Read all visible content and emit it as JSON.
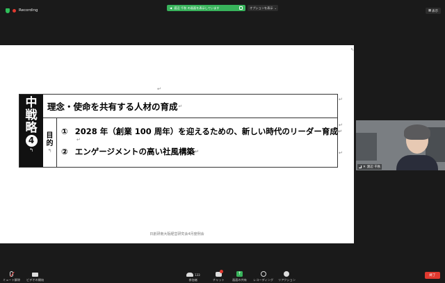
{
  "topbar": {
    "recording_label": "Recording",
    "share_notice": "渡辺 千秋 の画面を表示しています",
    "options_label": "オプションを表示",
    "view_label": "表示"
  },
  "slide": {
    "strategy_label_chars": [
      "中",
      "戦",
      "略"
    ],
    "strategy_number": "4",
    "title": "理念・使命を共有する人材の育成",
    "purpose_chars": [
      "目",
      "的"
    ],
    "items": [
      {
        "marker": "①",
        "text": "2028 年（創業 100 周年）を迎えるための、新しい時代のリーダー育成"
      },
      {
        "marker": "②",
        "text": "エンゲージメントの高い社風構築"
      }
    ],
    "footer": "日創研南大阪経営研究会4月度例会",
    "paragraph_mark": "↵",
    "return_mark": "↰"
  },
  "participant": {
    "name": "渡辺 千秋"
  },
  "toolbar": {
    "mute": "ミュート解除",
    "video": "ビデオの開始",
    "participants": "参加者",
    "participants_count": "133",
    "chat": "チャット",
    "share": "画面の共有",
    "record": "レコーディング",
    "reactions": "リアクション",
    "end": "終了"
  },
  "colors": {
    "share_green": "#38b35b",
    "record_red": "#e0392f",
    "end_red": "#e0392f"
  }
}
